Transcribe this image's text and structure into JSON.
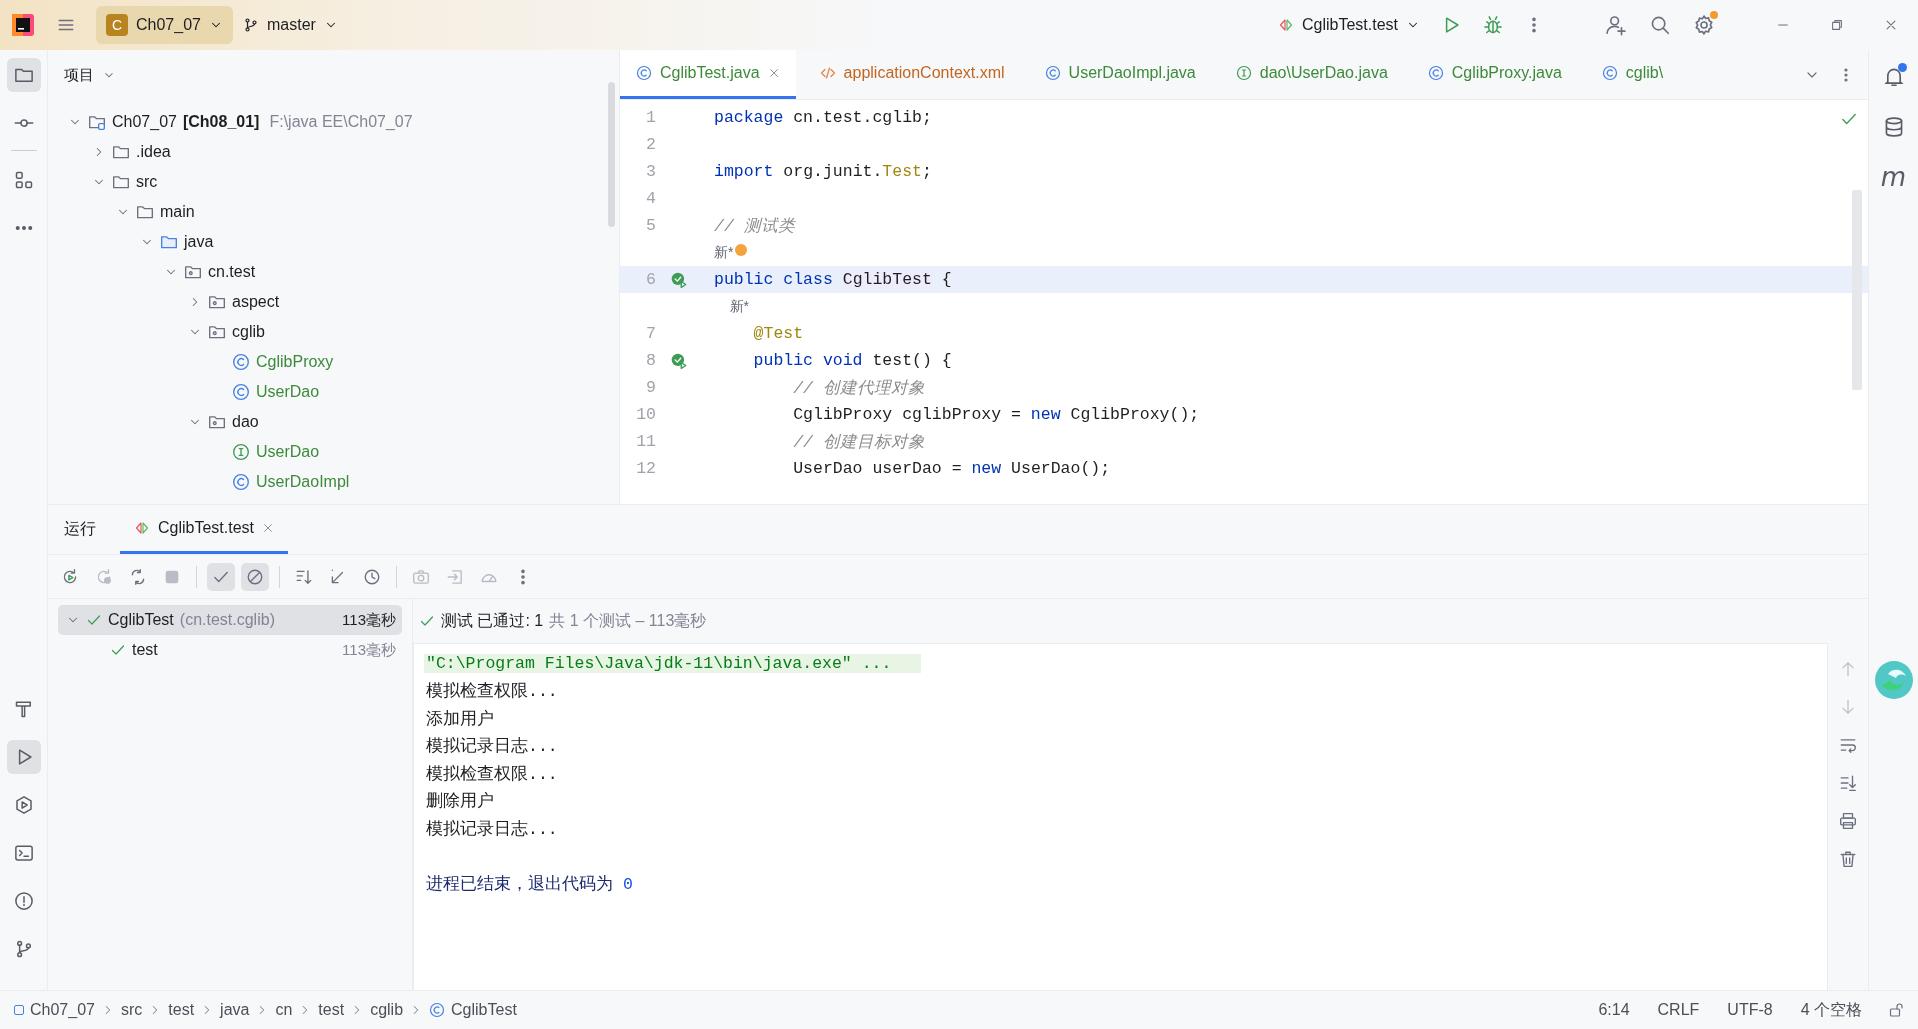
{
  "topbar": {
    "project": {
      "badge": "C",
      "name": "Ch07_07"
    },
    "branch": "master",
    "run_config": "CglibTest.test",
    "settings_badge": true
  },
  "left_strip": {
    "top": [
      {
        "kind": "folder",
        "selected": true
      },
      {
        "kind": "commit",
        "selected": false
      },
      {
        "kind": "structure",
        "selected": false
      },
      {
        "kind": "more",
        "selected": false
      }
    ],
    "bottom": [
      {
        "kind": "build",
        "selected": false
      },
      {
        "kind": "run",
        "selected": true
      },
      {
        "kind": "services",
        "selected": false
      },
      {
        "kind": "terminal",
        "selected": false
      },
      {
        "kind": "problems",
        "selected": false
      },
      {
        "kind": "git",
        "selected": false
      }
    ]
  },
  "project": {
    "title": "项目",
    "tree": [
      {
        "kind": "module",
        "label": "Ch07_07",
        "alias": "[Ch08_01]",
        "path": "F:\\java EE\\Ch07_07",
        "expanded": true,
        "children": [
          {
            "kind": "folder",
            "label": ".idea",
            "expanded": false
          },
          {
            "kind": "folder",
            "label": "src",
            "expanded": true,
            "children": [
              {
                "kind": "folder",
                "label": "main",
                "expanded": true,
                "children": [
                  {
                    "kind": "source",
                    "label": "java",
                    "expanded": true,
                    "children": [
                      {
                        "kind": "package",
                        "label": "cn.test",
                        "expanded": true,
                        "children": [
                          {
                            "kind": "package",
                            "label": "aspect",
                            "expanded": false
                          },
                          {
                            "kind": "package",
                            "label": "cglib",
                            "expanded": true,
                            "children": [
                              {
                                "kind": "class",
                                "label": "CglibProxy",
                                "color": "#3d8a3a"
                              },
                              {
                                "kind": "class",
                                "label": "UserDao",
                                "color": "#3d8a3a"
                              }
                            ]
                          },
                          {
                            "kind": "package",
                            "label": "dao",
                            "expanded": true,
                            "children": [
                              {
                                "kind": "interface",
                                "label": "UserDao",
                                "color": "#3d8a3a"
                              },
                              {
                                "kind": "class",
                                "label": "UserDaoImpl",
                                "color": "#3d8a3a"
                              }
                            ]
                          }
                        ]
                      }
                    ]
                  }
                ]
              }
            ]
          }
        ]
      }
    ]
  },
  "editor": {
    "tabs": [
      {
        "kind": "class",
        "label": "CglibTest.java",
        "selected": true,
        "color": "#3d8a3a"
      },
      {
        "kind": "xml",
        "label": "applicationContext.xml",
        "selected": false,
        "color": "#c2661f"
      },
      {
        "kind": "class",
        "label": "UserDaoImpl.java",
        "selected": false,
        "color": "#3d8a3a"
      },
      {
        "kind": "interface",
        "label": "dao\\UserDao.java",
        "selected": false,
        "color": "#3d8a3a"
      },
      {
        "kind": "class",
        "label": "CglibProxy.java",
        "selected": false,
        "color": "#3d8a3a"
      },
      {
        "kind": "class",
        "label": "cglib\\",
        "selected": false,
        "color": "#3d8a3a"
      }
    ],
    "lines": [
      {
        "kind": "code",
        "number": "1",
        "run": false,
        "current": false,
        "segments": [
          {
            "kind": "keyword",
            "text": "package"
          },
          {
            "kind": "plain",
            "text": " cn.test.cglib;"
          }
        ]
      },
      {
        "kind": "code",
        "number": "2",
        "run": false,
        "current": false
      },
      {
        "kind": "code",
        "number": "3",
        "run": false,
        "current": false,
        "segments": [
          {
            "kind": "keyword",
            "text": "import"
          },
          {
            "kind": "plain",
            "text": " org.junit."
          },
          {
            "kind": "annotation",
            "text": "Test"
          },
          {
            "kind": "plain",
            "text": ";"
          }
        ]
      },
      {
        "kind": "code",
        "number": "4",
        "run": false,
        "current": false
      },
      {
        "kind": "code",
        "number": "5",
        "run": false,
        "current": false,
        "segments": [
          {
            "kind": "comment",
            "text": "// 测试类"
          }
        ]
      },
      {
        "kind": "hint",
        "text": "新*",
        "bulb": true
      },
      {
        "kind": "code",
        "number": "6",
        "run": true,
        "current": true,
        "segments": [
          {
            "kind": "keyword",
            "text": "public class "
          },
          {
            "kind": "highlight",
            "text": "CglibTest"
          },
          {
            "kind": "plain",
            "text": " {"
          }
        ]
      },
      {
        "kind": "hint",
        "text": "    新*",
        "bulb": false
      },
      {
        "kind": "code",
        "number": "7",
        "run": false,
        "current": false,
        "segments": [
          {
            "kind": "annotation",
            "text": "    @Test"
          }
        ]
      },
      {
        "kind": "code",
        "number": "8",
        "run": true,
        "current": false,
        "segments": [
          {
            "kind": "keyword",
            "text": "    public void "
          },
          {
            "kind": "plain",
            "text": "test() {"
          }
        ]
      },
      {
        "kind": "code",
        "number": "9",
        "run": false,
        "current": false,
        "segments": [
          {
            "kind": "comment",
            "text": "        // 创建代理对象"
          }
        ]
      },
      {
        "kind": "code",
        "number": "10",
        "run": false,
        "current": false,
        "segments": [
          {
            "kind": "plain",
            "text": "        CglibProxy cglibProxy = "
          },
          {
            "kind": "keyword",
            "text": "new"
          },
          {
            "kind": "plain",
            "text": " CglibProxy();"
          }
        ]
      },
      {
        "kind": "code",
        "number": "11",
        "run": false,
        "current": false,
        "segments": [
          {
            "kind": "comment",
            "text": "        // 创建目标对象"
          }
        ]
      },
      {
        "kind": "code",
        "number": "12",
        "run": false,
        "current": false,
        "segments": [
          {
            "kind": "plain",
            "text": "        UserDao userDao = "
          },
          {
            "kind": "keyword",
            "text": "new"
          },
          {
            "kind": "plain",
            "text": " UserDao();"
          }
        ]
      }
    ]
  },
  "right_strip": [
    {
      "kind": "notifications",
      "badge": true
    },
    {
      "kind": "database",
      "badge": false
    },
    {
      "kind": "maven",
      "text": "m",
      "badge": false
    }
  ],
  "run": {
    "title": "运行",
    "tabs": [
      {
        "label": "CglibTest.test",
        "selected": true
      }
    ],
    "toolbar": [
      {
        "kind": "rerun",
        "disabled": false,
        "on": false
      },
      {
        "kind": "rerun-failed",
        "disabled": true,
        "on": false
      },
      {
        "kind": "toggle-auto",
        "disabled": false,
        "on": false
      },
      {
        "kind": "stop",
        "disabled": true,
        "on": false
      },
      {
        "kind": "show-passed",
        "disabled": false,
        "on": true
      },
      {
        "kind": "show-ignored",
        "disabled": false,
        "on": true
      },
      {
        "kind": "sort",
        "disabled": false,
        "on": false
      },
      {
        "kind": "collapse",
        "disabled": false,
        "on": false
      },
      {
        "kind": "history",
        "disabled": false,
        "on": false
      },
      {
        "kind": "camera",
        "disabled": true,
        "on": false
      },
      {
        "kind": "export",
        "disabled": true,
        "on": false
      },
      {
        "kind": "coverage",
        "disabled": true,
        "on": false
      },
      {
        "kind": "more",
        "disabled": false,
        "on": false
      }
    ],
    "tests": [
      {
        "label": "CglibTest",
        "detail": "(cn.test.cglib)",
        "time": "113毫秒",
        "passed": true,
        "selected": true,
        "expanded": true,
        "children": [
          {
            "label": "test",
            "time": "113毫秒",
            "passed": true,
            "selected": false
          }
        ]
      }
    ],
    "summary": {
      "passed": true,
      "status": "测试 已通过: 1",
      "detail": "共 1 个测试 – 113毫秒"
    },
    "console": [
      {
        "kind": "command",
        "text": "\"C:\\Program Files\\Java\\jdk-11\\bin\\java.exe\" ..."
      },
      {
        "kind": "output",
        "text": "模拟检查权限..."
      },
      {
        "kind": "output",
        "text": "添加用户"
      },
      {
        "kind": "output",
        "text": "模拟记录日志..."
      },
      {
        "kind": "output",
        "text": "模拟检查权限..."
      },
      {
        "kind": "output",
        "text": "删除用户"
      },
      {
        "kind": "output",
        "text": "模拟记录日志..."
      },
      {
        "kind": "blank"
      },
      {
        "kind": "exit",
        "text": "进程已结束，退出代码为 ",
        "code": "0"
      }
    ],
    "side_tools": [
      {
        "kind": "up",
        "disabled": true
      },
      {
        "kind": "down",
        "disabled": true
      },
      {
        "kind": "wrap",
        "disabled": false
      },
      {
        "kind": "scroll-end",
        "disabled": false
      },
      {
        "kind": "print",
        "disabled": false
      },
      {
        "kind": "trash",
        "disabled": false
      }
    ]
  },
  "status_bar": {
    "breadcrumbs": [
      {
        "kind": "module",
        "label": "Ch07_07"
      },
      {
        "kind": "dir",
        "label": "src"
      },
      {
        "kind": "dir",
        "label": "test"
      },
      {
        "kind": "dir",
        "label": "java"
      },
      {
        "kind": "dir",
        "label": "cn"
      },
      {
        "kind": "dir",
        "label": "test"
      },
      {
        "kind": "dir",
        "label": "cglib"
      },
      {
        "kind": "class",
        "label": "CglibTest"
      }
    ],
    "items": [
      "6:14",
      "CRLF",
      "UTF-8",
      "4 个空格"
    ],
    "locked": false
  }
}
